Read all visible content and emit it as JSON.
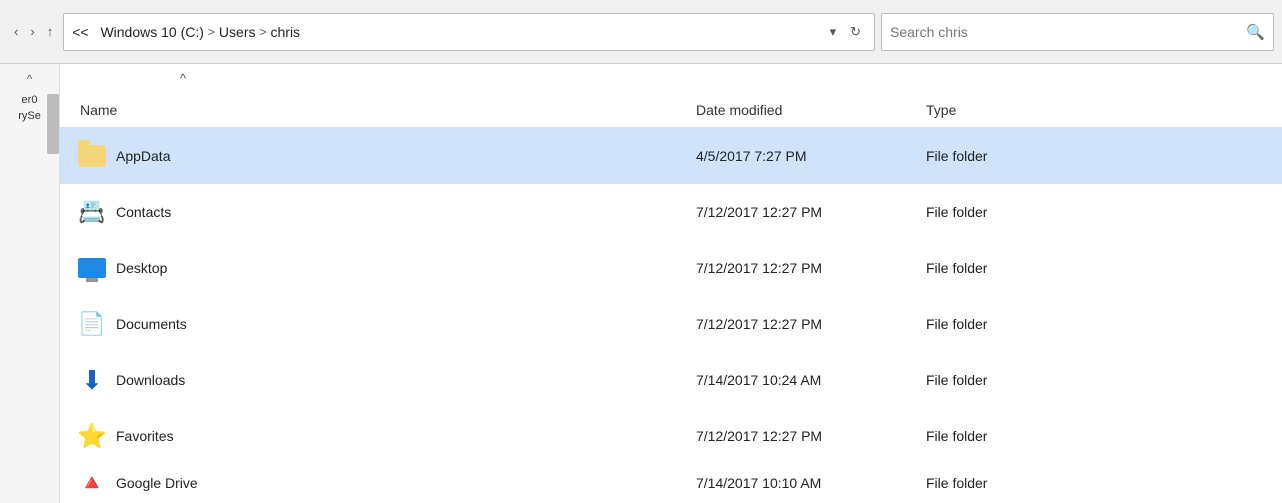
{
  "addressbar": {
    "breadcrumb": {
      "separator": "<<",
      "parts": [
        "Windows 10 (C:)",
        "Users",
        "chris"
      ],
      "separators": [
        ">",
        ">"
      ]
    },
    "refresh_label": "↻",
    "dropdown_label": "▾"
  },
  "search": {
    "placeholder": "Search chris",
    "icon": "🔍"
  },
  "columns": {
    "name": "Name",
    "date_modified": "Date modified",
    "type": "Type"
  },
  "files": [
    {
      "name": "AppData",
      "date": "4/5/2017 7:27 PM",
      "type": "File folder",
      "icon": "folder-plain",
      "selected": true
    },
    {
      "name": "Contacts",
      "date": "7/12/2017 12:27 PM",
      "type": "File folder",
      "icon": "contacts",
      "selected": false
    },
    {
      "name": "Desktop",
      "date": "7/12/2017 12:27 PM",
      "type": "File folder",
      "icon": "desktop",
      "selected": false
    },
    {
      "name": "Documents",
      "date": "7/12/2017 12:27 PM",
      "type": "File folder",
      "icon": "documents",
      "selected": false
    },
    {
      "name": "Downloads",
      "date": "7/14/2017 10:24 AM",
      "type": "File folder",
      "icon": "downloads",
      "selected": false
    },
    {
      "name": "Favorites",
      "date": "7/12/2017 12:27 PM",
      "type": "File folder",
      "icon": "favorites",
      "selected": false
    },
    {
      "name": "Google Drive",
      "date": "7/14/2017 10:10 AM",
      "type": "File folder",
      "icon": "googledrive",
      "selected": false,
      "partial": true
    }
  ],
  "sidebar": {
    "scroll_up": "^",
    "label1": "er0",
    "label2": "rySe"
  }
}
